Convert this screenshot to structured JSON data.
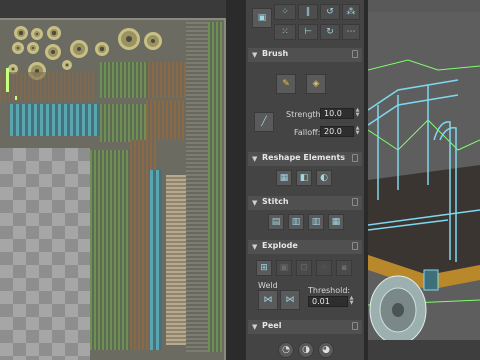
{
  "toolbar": {
    "icons": [
      "select-icon",
      "move-uv-icon",
      "stretch-icon",
      "rotate-ccw-icon",
      "flip-icon",
      "scale-icon",
      "rotate-cw-icon"
    ]
  },
  "brush": {
    "title": "Brush",
    "strength_label": "Strength:",
    "strength_value": "10.0",
    "falloff_label": "Falloff:",
    "falloff_value": "20.0"
  },
  "reshape": {
    "title": "Reshape Elements"
  },
  "stitch": {
    "title": "Stitch"
  },
  "explode": {
    "title": "Explode",
    "weld_label": "Weld",
    "threshold_label": "Threshold:",
    "threshold_value": "0.01"
  },
  "peel": {
    "title": "Peel"
  },
  "colors": {
    "panel_bg": "#444444",
    "rollout_header": "#505050",
    "uv_bg": "#6b6b62",
    "wire_green": "#7cff6a",
    "wire_cyan": "#7fd8ef"
  }
}
